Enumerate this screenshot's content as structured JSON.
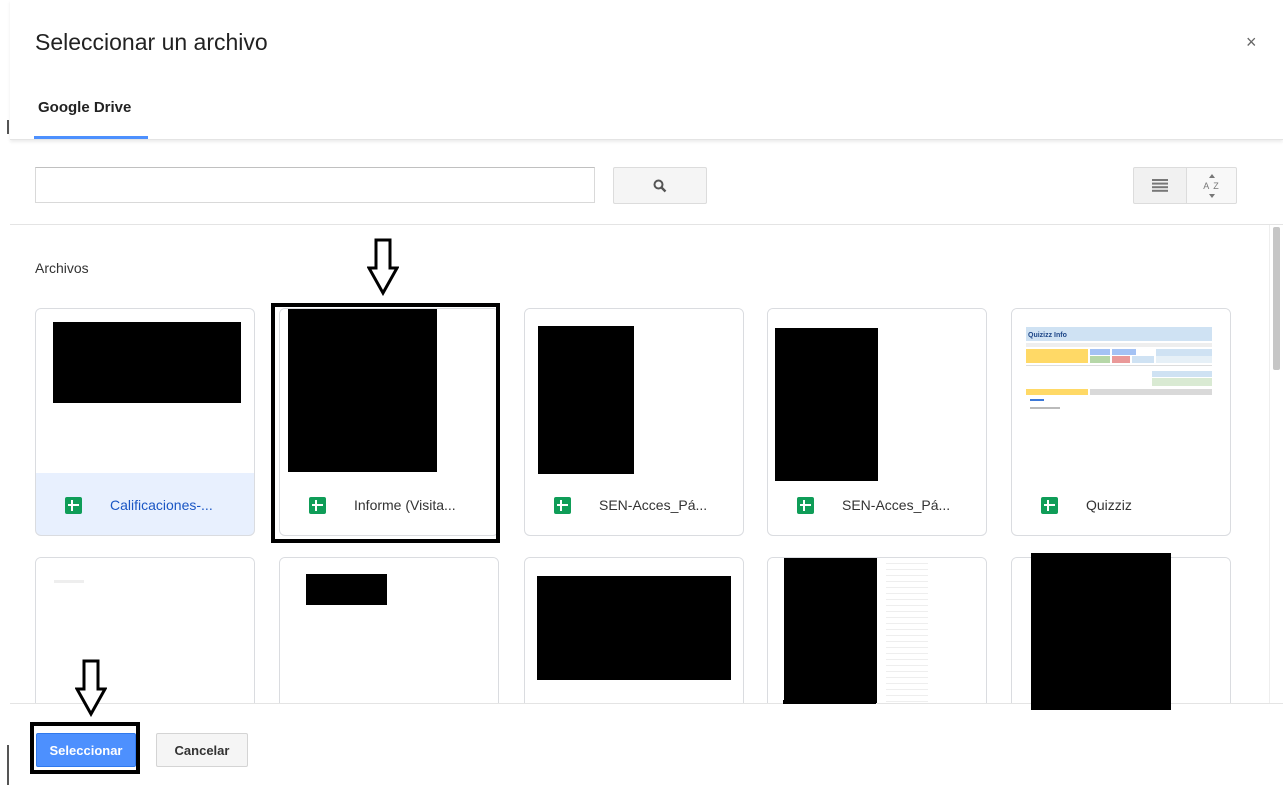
{
  "dialog": {
    "title": "Seleccionar un archivo",
    "close_label": "×"
  },
  "tabs": [
    {
      "label": "Google Drive",
      "active": true
    }
  ],
  "search": {
    "value": "",
    "placeholder": "",
    "button_icon": "search-icon"
  },
  "view_controls": {
    "list_icon": "list-view-icon",
    "sort_label": "A Z"
  },
  "section": {
    "title": "Archivos"
  },
  "files": [
    {
      "name": "Calificaciones-...",
      "type": "spreadsheet",
      "selected": true
    },
    {
      "name": "Informe (Visita...",
      "type": "spreadsheet",
      "selected": false
    },
    {
      "name": "SEN-Acces_Pá...",
      "type": "spreadsheet",
      "selected": false
    },
    {
      "name": "SEN-Acces_Pá...",
      "type": "spreadsheet",
      "selected": false
    },
    {
      "name": "Quizziz",
      "type": "spreadsheet",
      "selected": false
    }
  ],
  "quizziz_preview": {
    "heading": "Quizizz Info"
  },
  "footer": {
    "select_label": "Seleccionar",
    "cancel_label": "Cancelar"
  },
  "colors": {
    "accent": "#4d90fe",
    "sheets_green": "#0f9d58",
    "selected_bg": "#e8f0fe"
  }
}
